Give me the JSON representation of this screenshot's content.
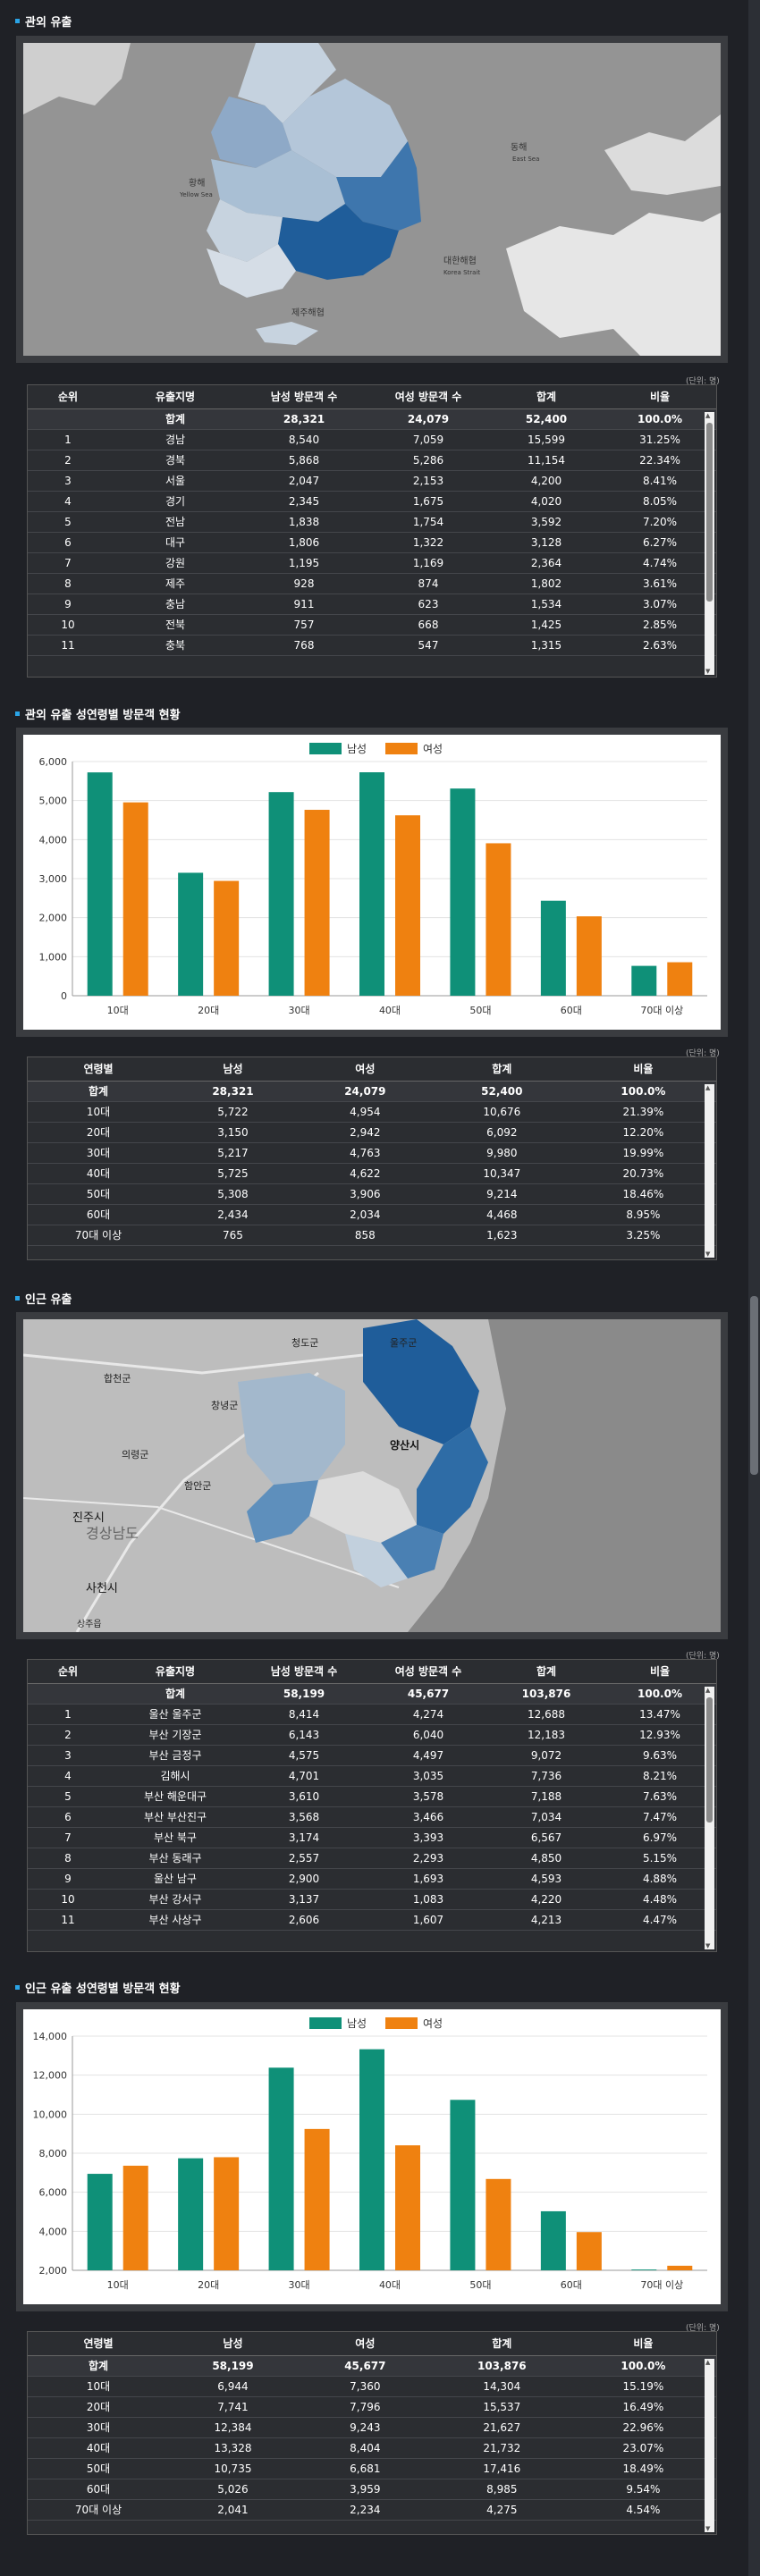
{
  "colors": {
    "male": "#0f9078",
    "female": "#ef8110",
    "accent": "#2aa4e6"
  },
  "sections": {
    "far_title": "관외 유출",
    "far_chart_title": "관외 유출 성연령별 방문객 현황",
    "near_title": "인근 유출",
    "near_chart_title": "인근 유출 성연령별 방문객 현황"
  },
  "unit_label": "(단위: 명)",
  "far_map": {
    "labels": [
      "황해",
      "Yellow Sea",
      "동해",
      "East Sea",
      "대한해협",
      "Korea Strait",
      "제주해협"
    ]
  },
  "near_map": {
    "labels": [
      "합천군",
      "창녕군",
      "청도군",
      "울주군",
      "의령군",
      "함안군",
      "양산시",
      "진주시",
      "경상남도",
      "사천시",
      "상주읍"
    ]
  },
  "far_table": {
    "headers": [
      "순위",
      "유출지명",
      "남성 방문객 수",
      "여성 방문객 수",
      "합계",
      "비율"
    ],
    "total": [
      "",
      "합계",
      "28,321",
      "24,079",
      "52,400",
      "100.0%"
    ],
    "rows": [
      [
        "1",
        "경남",
        "8,540",
        "7,059",
        "15,599",
        "31.25%"
      ],
      [
        "2",
        "경북",
        "5,868",
        "5,286",
        "11,154",
        "22.34%"
      ],
      [
        "3",
        "서울",
        "2,047",
        "2,153",
        "4,200",
        "8.41%"
      ],
      [
        "4",
        "경기",
        "2,345",
        "1,675",
        "4,020",
        "8.05%"
      ],
      [
        "5",
        "전남",
        "1,838",
        "1,754",
        "3,592",
        "7.20%"
      ],
      [
        "6",
        "대구",
        "1,806",
        "1,322",
        "3,128",
        "6.27%"
      ],
      [
        "7",
        "강원",
        "1,195",
        "1,169",
        "2,364",
        "4.74%"
      ],
      [
        "8",
        "제주",
        "928",
        "874",
        "1,802",
        "3.61%"
      ],
      [
        "9",
        "충남",
        "911",
        "623",
        "1,534",
        "3.07%"
      ],
      [
        "10",
        "전북",
        "757",
        "668",
        "1,425",
        "2.85%"
      ],
      [
        "11",
        "충북",
        "768",
        "547",
        "1,315",
        "2.63%"
      ]
    ]
  },
  "far_age_table": {
    "headers": [
      "연령별",
      "남성",
      "여성",
      "합계",
      "비율"
    ],
    "total": [
      "합계",
      "28,321",
      "24,079",
      "52,400",
      "100.0%"
    ],
    "rows": [
      [
        "10대",
        "5,722",
        "4,954",
        "10,676",
        "21.39%"
      ],
      [
        "20대",
        "3,150",
        "2,942",
        "6,092",
        "12.20%"
      ],
      [
        "30대",
        "5,217",
        "4,763",
        "9,980",
        "19.99%"
      ],
      [
        "40대",
        "5,725",
        "4,622",
        "10,347",
        "20.73%"
      ],
      [
        "50대",
        "5,308",
        "3,906",
        "9,214",
        "18.46%"
      ],
      [
        "60대",
        "2,434",
        "2,034",
        "4,468",
        "8.95%"
      ],
      [
        "70대 이상",
        "765",
        "858",
        "1,623",
        "3.25%"
      ]
    ]
  },
  "near_table": {
    "headers": [
      "순위",
      "유출지명",
      "남성 방문객 수",
      "여성 방문객 수",
      "합계",
      "비율"
    ],
    "total": [
      "",
      "합계",
      "58,199",
      "45,677",
      "103,876",
      "100.0%"
    ],
    "rows": [
      [
        "1",
        "울산 울주군",
        "8,414",
        "4,274",
        "12,688",
        "13.47%"
      ],
      [
        "2",
        "부산 기장군",
        "6,143",
        "6,040",
        "12,183",
        "12.93%"
      ],
      [
        "3",
        "부산 금정구",
        "4,575",
        "4,497",
        "9,072",
        "9.63%"
      ],
      [
        "4",
        "김해시",
        "4,701",
        "3,035",
        "7,736",
        "8.21%"
      ],
      [
        "5",
        "부산 해운대구",
        "3,610",
        "3,578",
        "7,188",
        "7.63%"
      ],
      [
        "6",
        "부산 부산진구",
        "3,568",
        "3,466",
        "7,034",
        "7.47%"
      ],
      [
        "7",
        "부산 북구",
        "3,174",
        "3,393",
        "6,567",
        "6.97%"
      ],
      [
        "8",
        "부산 동래구",
        "2,557",
        "2,293",
        "4,850",
        "5.15%"
      ],
      [
        "9",
        "울산 남구",
        "2,900",
        "1,693",
        "4,593",
        "4.88%"
      ],
      [
        "10",
        "부산 강서구",
        "3,137",
        "1,083",
        "4,220",
        "4.48%"
      ],
      [
        "11",
        "부산 사상구",
        "2,606",
        "1,607",
        "4,213",
        "4.47%"
      ]
    ]
  },
  "near_age_table": {
    "headers": [
      "연령별",
      "남성",
      "여성",
      "합계",
      "비율"
    ],
    "total": [
      "합계",
      "58,199",
      "45,677",
      "103,876",
      "100.0%"
    ],
    "rows": [
      [
        "10대",
        "6,944",
        "7,360",
        "14,304",
        "15.19%"
      ],
      [
        "20대",
        "7,741",
        "7,796",
        "15,537",
        "16.49%"
      ],
      [
        "30대",
        "12,384",
        "9,243",
        "21,627",
        "22.96%"
      ],
      [
        "40대",
        "13,328",
        "8,404",
        "21,732",
        "23.07%"
      ],
      [
        "50대",
        "10,735",
        "6,681",
        "17,416",
        "18.49%"
      ],
      [
        "60대",
        "5,026",
        "3,959",
        "8,985",
        "9.54%"
      ],
      [
        "70대 이상",
        "2,041",
        "2,234",
        "4,275",
        "4.54%"
      ]
    ]
  },
  "chart_data": [
    {
      "type": "bar",
      "categories": [
        "10대",
        "20대",
        "30대",
        "40대",
        "50대",
        "60대",
        "70대 이상"
      ],
      "series": [
        {
          "name": "남성",
          "values": [
            5722,
            3150,
            5217,
            5725,
            5308,
            2434,
            765
          ]
        },
        {
          "name": "여성",
          "values": [
            4954,
            2942,
            4763,
            4622,
            3906,
            2034,
            858
          ]
        }
      ],
      "yticks": [
        "0",
        "1,000",
        "2,000",
        "3,000",
        "4,000",
        "5,000",
        "6,000"
      ],
      "ylim": [
        0,
        6000
      ],
      "legend": "top-center",
      "grid": true
    },
    {
      "type": "bar",
      "categories": [
        "10대",
        "20대",
        "30대",
        "40대",
        "50대",
        "60대",
        "70대 이상"
      ],
      "series": [
        {
          "name": "남성",
          "values": [
            6944,
            7741,
            12384,
            13328,
            10735,
            5026,
            2041
          ]
        },
        {
          "name": "여성",
          "values": [
            7360,
            7796,
            9243,
            8404,
            6681,
            3959,
            2234
          ]
        }
      ],
      "yticks": [
        "2,000",
        "4,000",
        "6,000",
        "8,000",
        "10,000",
        "12,000",
        "14,000"
      ],
      "ylim": [
        2000,
        14000
      ],
      "legend": "top-center",
      "grid": true
    }
  ]
}
